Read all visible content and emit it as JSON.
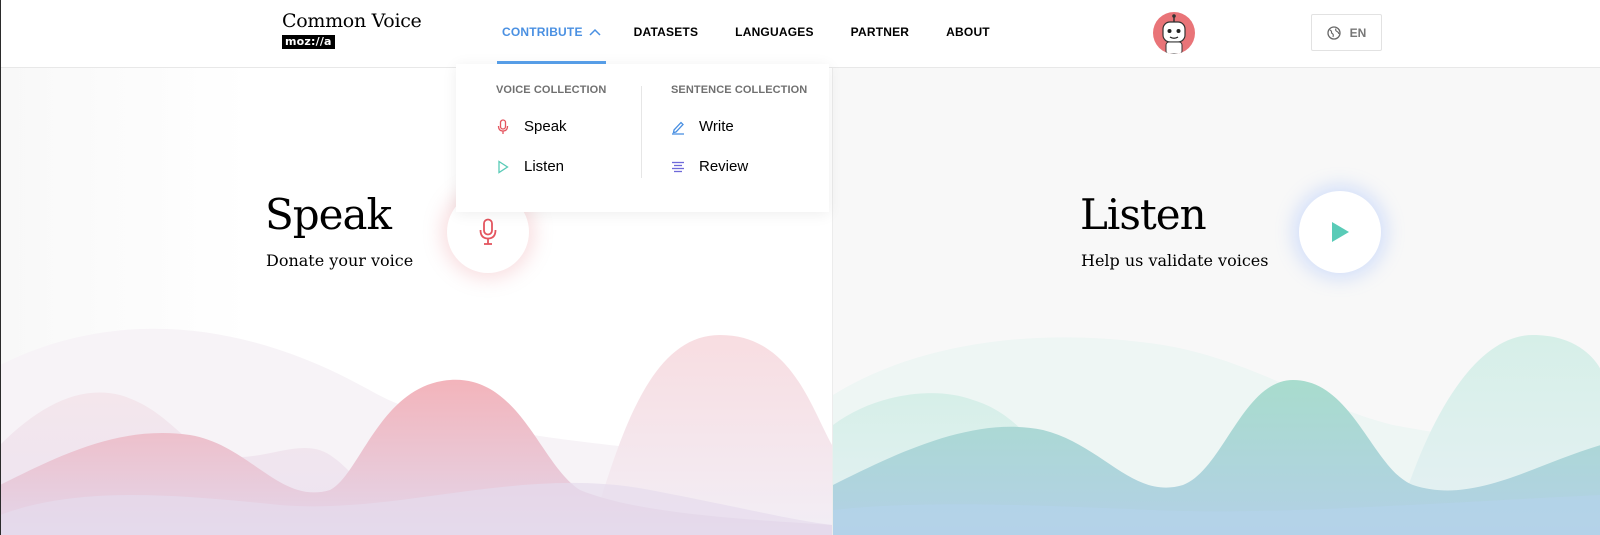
{
  "header": {
    "logo_title": "Common Voice",
    "logo_badge": "moz://a",
    "nav": [
      {
        "label": "CONTRIBUTE",
        "active": true
      },
      {
        "label": "DATASETS"
      },
      {
        "label": "LANGUAGES"
      },
      {
        "label": "PARTNER"
      },
      {
        "label": "ABOUT"
      }
    ],
    "language": "EN",
    "accent_color": "#4a90e2"
  },
  "dropdown": {
    "voice_collection": {
      "heading": "VOICE COLLECTION",
      "items": [
        {
          "label": "Speak",
          "icon": "microphone-icon"
        },
        {
          "label": "Listen",
          "icon": "play-icon"
        }
      ]
    },
    "sentence_collection": {
      "heading": "SENTENCE COLLECTION",
      "items": [
        {
          "label": "Write",
          "icon": "pencil-icon"
        },
        {
          "label": "Review",
          "icon": "review-lines-icon"
        }
      ]
    }
  },
  "speak_panel": {
    "title": "Speak",
    "subtitle": "Donate your voice",
    "color": "#e4555f"
  },
  "listen_panel": {
    "title": "Listen",
    "subtitle": "Help us validate voices",
    "color": "#59cbb7"
  }
}
